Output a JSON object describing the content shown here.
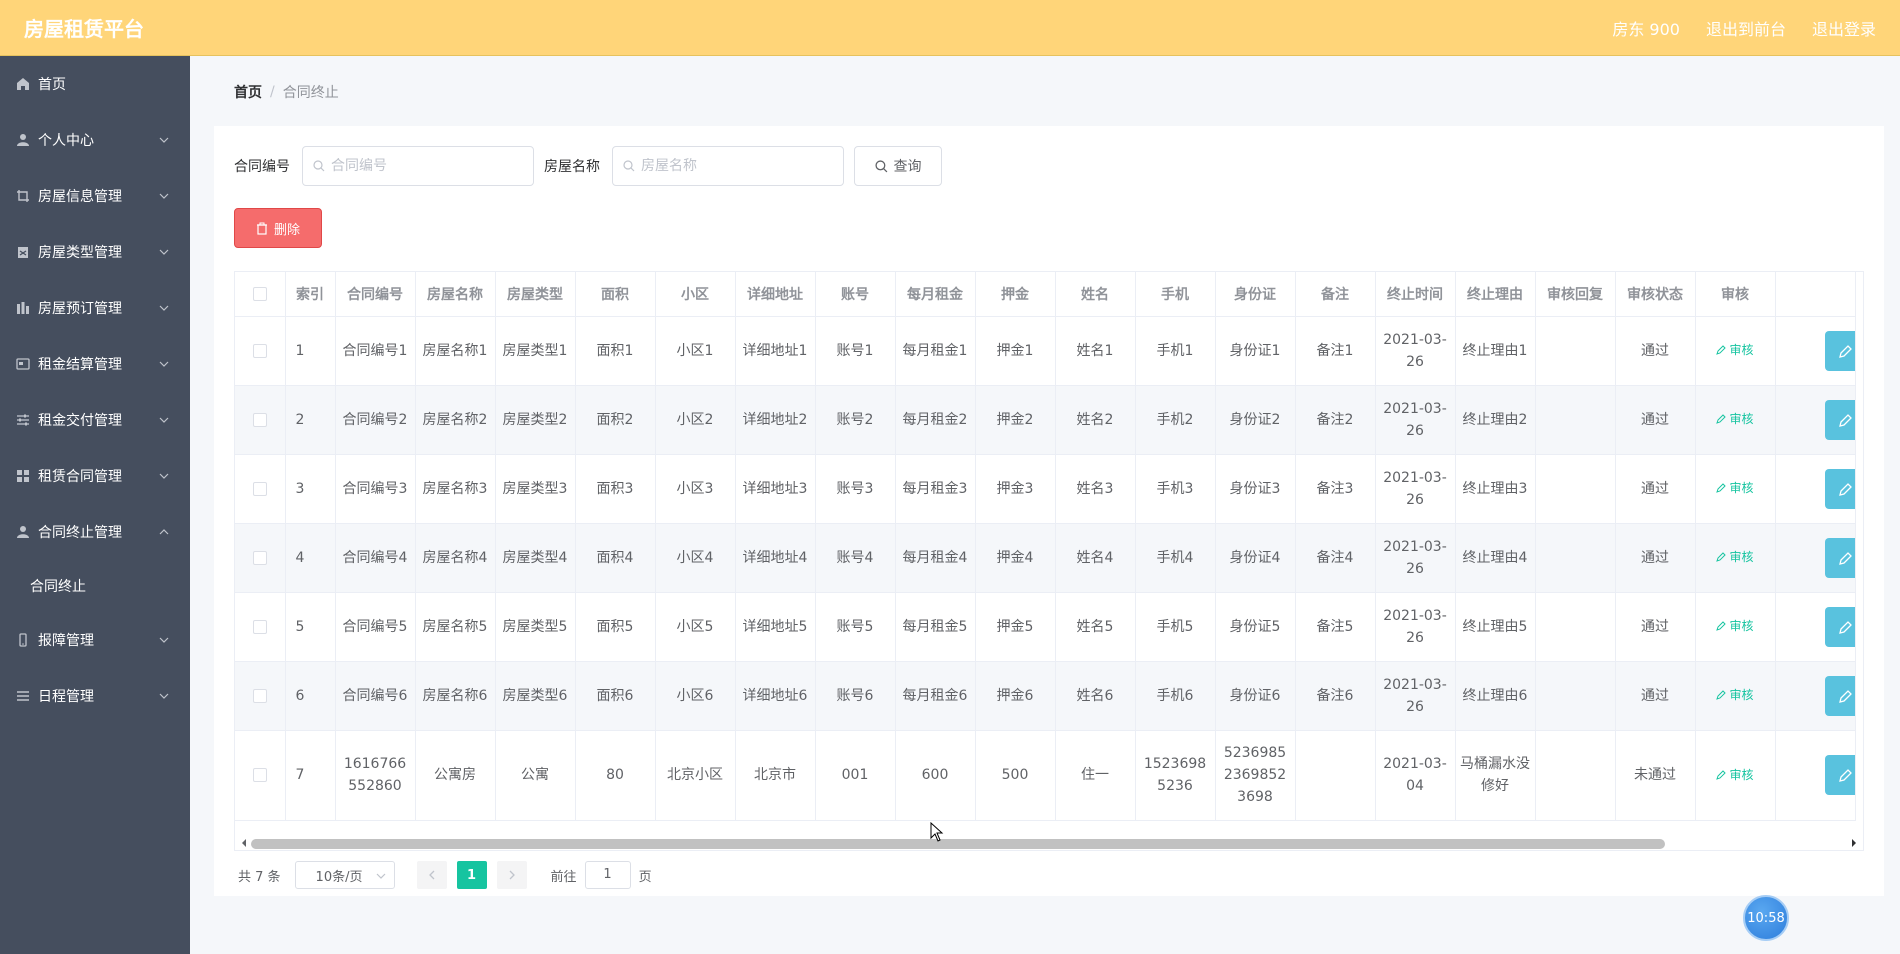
{
  "header": {
    "brand": "房屋租赁平台",
    "user": "房东 900",
    "back_to_front": "退出到前台",
    "logout": "退出登录"
  },
  "sidebar": {
    "items": [
      {
        "label": "首页",
        "icon": "home-icon",
        "expandable": false
      },
      {
        "label": "个人中心",
        "icon": "user-icon",
        "expandable": true
      },
      {
        "label": "房屋信息管理",
        "icon": "crop-icon",
        "expandable": true
      },
      {
        "label": "房屋类型管理",
        "icon": "clipboard-icon",
        "expandable": true
      },
      {
        "label": "房屋预订管理",
        "icon": "chart-icon",
        "expandable": true
      },
      {
        "label": "租金结算管理",
        "icon": "card-icon",
        "expandable": true
      },
      {
        "label": "租金交付管理",
        "icon": "sliders-icon",
        "expandable": true
      },
      {
        "label": "租赁合同管理",
        "icon": "grid-icon",
        "expandable": true
      },
      {
        "label": "合同终止管理",
        "icon": "user-icon",
        "expandable": true,
        "expanded": true
      },
      {
        "label": "报障管理",
        "icon": "phone-icon",
        "expandable": true
      },
      {
        "label": "日程管理",
        "icon": "list-icon",
        "expandable": true
      }
    ],
    "submenu": "合同终止"
  },
  "breadcrumb": {
    "home": "首页",
    "separator": "/",
    "current": "合同终止"
  },
  "search": {
    "contract_label": "合同编号",
    "contract_placeholder": "合同编号",
    "house_label": "房屋名称",
    "house_placeholder": "房屋名称",
    "query_button": "查询"
  },
  "delete_button": "删除",
  "table": {
    "columns": [
      "索引",
      "合同编号",
      "房屋名称",
      "房屋类型",
      "面积",
      "小区",
      "详细地址",
      "账号",
      "每月租金",
      "押金",
      "姓名",
      "手机",
      "身份证",
      "备注",
      "终止时间",
      "终止理由",
      "审核回复",
      "审核状态",
      "审核"
    ],
    "audit_label": "审核",
    "rows": [
      {
        "idx": "1",
        "contract": "合同编号1",
        "house": "房屋名称1",
        "type": "房屋类型1",
        "area": "面积1",
        "community": "小区1",
        "address": "详细地址1",
        "account": "账号1",
        "rent": "每月租金1",
        "deposit": "押金1",
        "name": "姓名1",
        "phone": "手机1",
        "idcard": "身份证1",
        "remark": "备注1",
        "end_time": "2021-03-26",
        "reason": "终止理由1",
        "reply": "",
        "status": "通过"
      },
      {
        "idx": "2",
        "contract": "合同编号2",
        "house": "房屋名称2",
        "type": "房屋类型2",
        "area": "面积2",
        "community": "小区2",
        "address": "详细地址2",
        "account": "账号2",
        "rent": "每月租金2",
        "deposit": "押金2",
        "name": "姓名2",
        "phone": "手机2",
        "idcard": "身份证2",
        "remark": "备注2",
        "end_time": "2021-03-26",
        "reason": "终止理由2",
        "reply": "",
        "status": "通过"
      },
      {
        "idx": "3",
        "contract": "合同编号3",
        "house": "房屋名称3",
        "type": "房屋类型3",
        "area": "面积3",
        "community": "小区3",
        "address": "详细地址3",
        "account": "账号3",
        "rent": "每月租金3",
        "deposit": "押金3",
        "name": "姓名3",
        "phone": "手机3",
        "idcard": "身份证3",
        "remark": "备注3",
        "end_time": "2021-03-26",
        "reason": "终止理由3",
        "reply": "",
        "status": "通过"
      },
      {
        "idx": "4",
        "contract": "合同编号4",
        "house": "房屋名称4",
        "type": "房屋类型4",
        "area": "面积4",
        "community": "小区4",
        "address": "详细地址4",
        "account": "账号4",
        "rent": "每月租金4",
        "deposit": "押金4",
        "name": "姓名4",
        "phone": "手机4",
        "idcard": "身份证4",
        "remark": "备注4",
        "end_time": "2021-03-26",
        "reason": "终止理由4",
        "reply": "",
        "status": "通过"
      },
      {
        "idx": "5",
        "contract": "合同编号5",
        "house": "房屋名称5",
        "type": "房屋类型5",
        "area": "面积5",
        "community": "小区5",
        "address": "详细地址5",
        "account": "账号5",
        "rent": "每月租金5",
        "deposit": "押金5",
        "name": "姓名5",
        "phone": "手机5",
        "idcard": "身份证5",
        "remark": "备注5",
        "end_time": "2021-03-26",
        "reason": "终止理由5",
        "reply": "",
        "status": "通过"
      },
      {
        "idx": "6",
        "contract": "合同编号6",
        "house": "房屋名称6",
        "type": "房屋类型6",
        "area": "面积6",
        "community": "小区6",
        "address": "详细地址6",
        "account": "账号6",
        "rent": "每月租金6",
        "deposit": "押金6",
        "name": "姓名6",
        "phone": "手机6",
        "idcard": "身份证6",
        "remark": "备注6",
        "end_time": "2021-03-26",
        "reason": "终止理由6",
        "reply": "",
        "status": "通过"
      },
      {
        "idx": "7",
        "contract": "1616766552860",
        "house": "公寓房",
        "type": "公寓",
        "area": "80",
        "community": "北京小区",
        "address": "北京市",
        "account": "001",
        "rent": "600",
        "deposit": "500",
        "name": "住一",
        "phone": "15236985236",
        "idcard": "523698523698523698",
        "remark": "",
        "end_time": "2021-03-04",
        "reason": "马桶漏水没修好",
        "reply": "",
        "status": "未通过"
      }
    ]
  },
  "pagination": {
    "total": "共 7 条",
    "page_size": "10条/页",
    "current_page": "1",
    "goto_prefix": "前往",
    "goto_value": "1",
    "goto_suffix": "页"
  },
  "clock": "10:58",
  "colors": {
    "header_bg": "#ffd579",
    "sidebar_bg": "#454e5e",
    "danger": "#f56c6c",
    "accent": "#16c4a0",
    "edit_button": "#59c2de"
  }
}
